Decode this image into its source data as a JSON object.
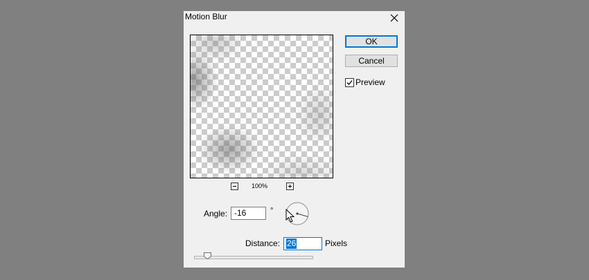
{
  "dialog": {
    "title": "Motion Blur",
    "ok_label": "OK",
    "cancel_label": "Cancel",
    "preview_label": "Preview",
    "preview_checked": true,
    "zoom": {
      "level": "100%",
      "zoom_out_icon": "minus-square-icon",
      "zoom_in_icon": "plus-square-icon"
    },
    "angle": {
      "label": "Angle:",
      "value": "-16",
      "unit": "°"
    },
    "distance": {
      "label": "Distance:",
      "value": "26",
      "unit": "Pixels",
      "slider_fraction": 0.1
    }
  },
  "colors": {
    "backdrop": "#808080",
    "dialog_bg": "#f0f0f0",
    "accent": "#0078d7"
  }
}
